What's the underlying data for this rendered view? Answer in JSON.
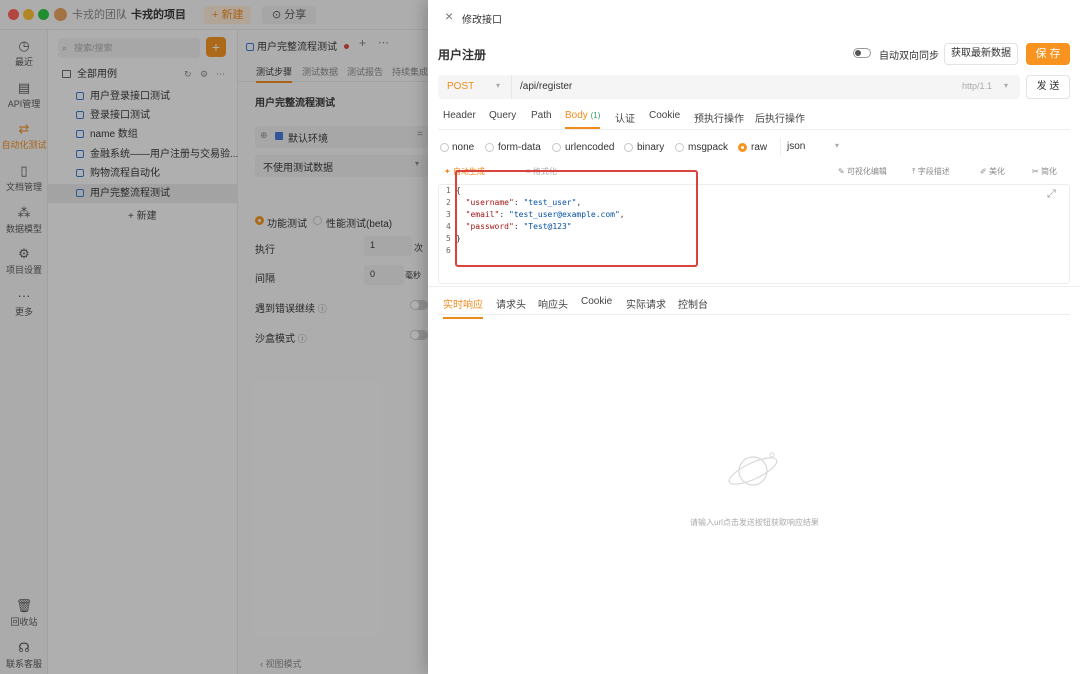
{
  "titlebar": {
    "team": "卡戎的团队",
    "separator": "/",
    "project": "卡戎的项目",
    "new_label": "新建",
    "share_label": "分享"
  },
  "nav": {
    "items": [
      {
        "label": "最近",
        "icon": "clock-icon"
      },
      {
        "label": "API管理",
        "icon": "api-icon"
      },
      {
        "label": "自动化测试",
        "icon": "automation-icon",
        "active": true
      },
      {
        "label": "文档管理",
        "icon": "document-icon"
      },
      {
        "label": "数据模型",
        "icon": "data-model-icon"
      },
      {
        "label": "项目设置",
        "icon": "settings-icon"
      },
      {
        "label": "更多",
        "icon": "more-icon"
      }
    ],
    "trash": "回收站",
    "support": "联系客服"
  },
  "tree": {
    "search_placeholder": "搜索/搜索",
    "root": "全部用例",
    "items": [
      "用户登录接口测试",
      "登录接口测试",
      "name 数组",
      "金融系统——用户注册与交易验...",
      "购物流程自动化",
      "用户完整流程测试"
    ],
    "new_label": "新建"
  },
  "middle": {
    "tab_title": "用户完整流程测试",
    "subtabs": [
      "测试步骤",
      "测试数据",
      "测试报告",
      "持续集成"
    ],
    "heading": "用户完整流程测试",
    "env": "默认环境",
    "data_select": "不使用测试数据",
    "mode_functional": "功能测试",
    "mode_performance": "性能测试(beta)",
    "exec_label": "执行",
    "exec_value": "1",
    "exec_unit": "次",
    "interval_label": "间隔",
    "interval_value": "0",
    "interval_unit": "毫秒",
    "on_error_label": "遇到错误继续",
    "sandbox_label": "沙盒模式",
    "footer": "视图模式"
  },
  "panel": {
    "close": "×",
    "header_title": "修改接口",
    "api_name": "用户注册",
    "sync_label": "自动双向同步",
    "fetch_label": "获取最新数据",
    "save_label": "保 存",
    "method": "POST",
    "url": "/api/register",
    "http_version": "http/1.1",
    "send_label": "发 送",
    "request_tabs": [
      "Header",
      "Query",
      "Path",
      "Body",
      "认证",
      "Cookie",
      "预执行操作",
      "后执行操作"
    ],
    "body_count": "(1)",
    "body_types": [
      "none",
      "form-data",
      "urlencoded",
      "binary",
      "msgpack",
      "raw"
    ],
    "raw_format": "json",
    "editor_tools_left": [
      "自动生成",
      "格式化"
    ],
    "editor_tools_right": [
      "可视化编辑",
      "字段描述",
      "美化",
      "简化"
    ],
    "code_lines": [
      "{",
      "  \"username\": \"test_user\",",
      "  \"email\": \"test_user@example.com\",",
      "  \"password\": \"Test@123\"",
      "}",
      ""
    ],
    "line_numbers": [
      "1",
      "2",
      "3",
      "4",
      "5",
      "6"
    ],
    "response_tabs": [
      "实时响应",
      "请求头",
      "响应头",
      "Cookie",
      "实际请求",
      "控制台"
    ],
    "empty_text": "请输入url点击发送按钮获取响应结果"
  },
  "colors": {
    "accent": "#f7931e",
    "highlight": "#d9433b",
    "icon_blue": "#3a78d6"
  }
}
